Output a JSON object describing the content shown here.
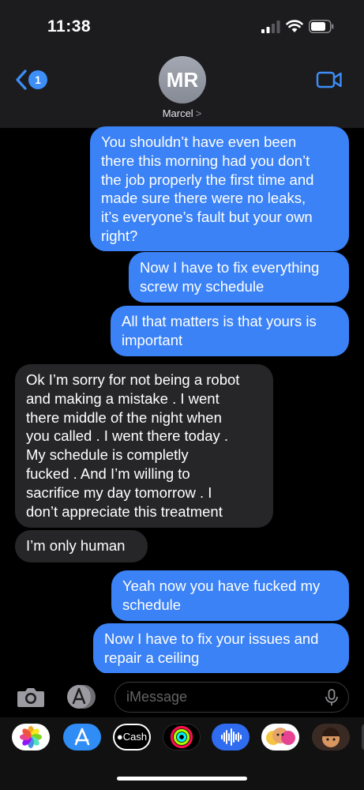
{
  "status_bar": {
    "time": "11:38"
  },
  "header": {
    "back_badge": "1",
    "avatar_initials": "MR",
    "contact_name": "Marcel",
    "contact_chevron": ">"
  },
  "messages": [
    {
      "direction": "sent",
      "text": "You shouldn’t have even been\nthere this morning had you don’t\nthe job properly the first time and\nmade sure there were no leaks,\nit’s everyone’s fault but your own\nright?"
    },
    {
      "direction": "sent",
      "text": "Now I have to fix everything\nscrew my schedule"
    },
    {
      "direction": "sent",
      "text": "All that matters is that yours is\nimportant"
    },
    {
      "direction": "received",
      "text": "Ok I’m sorry for not being a robot\nand making a mistake . I went\nthere middle of the night when\nyou called . I went there today .\nMy schedule is completly\nfucked . And I’m willing to\nsacrifice my day tomorrow . I\ndon’t appreciate this treatment"
    },
    {
      "direction": "received",
      "text": "I’m only human"
    },
    {
      "direction": "sent",
      "text": "Yeah now you have fucked my\nschedule"
    },
    {
      "direction": "sent",
      "text": "Now I have to fix your issues and\nrepair a ceiling"
    }
  ],
  "input": {
    "placeholder": "iMessage"
  },
  "app_drawer": {
    "apps": [
      "photos-app",
      "app-store-app",
      "cash-app",
      "activity-app",
      "audio-message-app",
      "memoji-stickers-app",
      "memoji-app"
    ],
    "cash_label": "Cash"
  },
  "colors": {
    "sent_bubble": "#3b82f6",
    "received_bubble": "#262628",
    "accent": "#3d8ef7"
  }
}
